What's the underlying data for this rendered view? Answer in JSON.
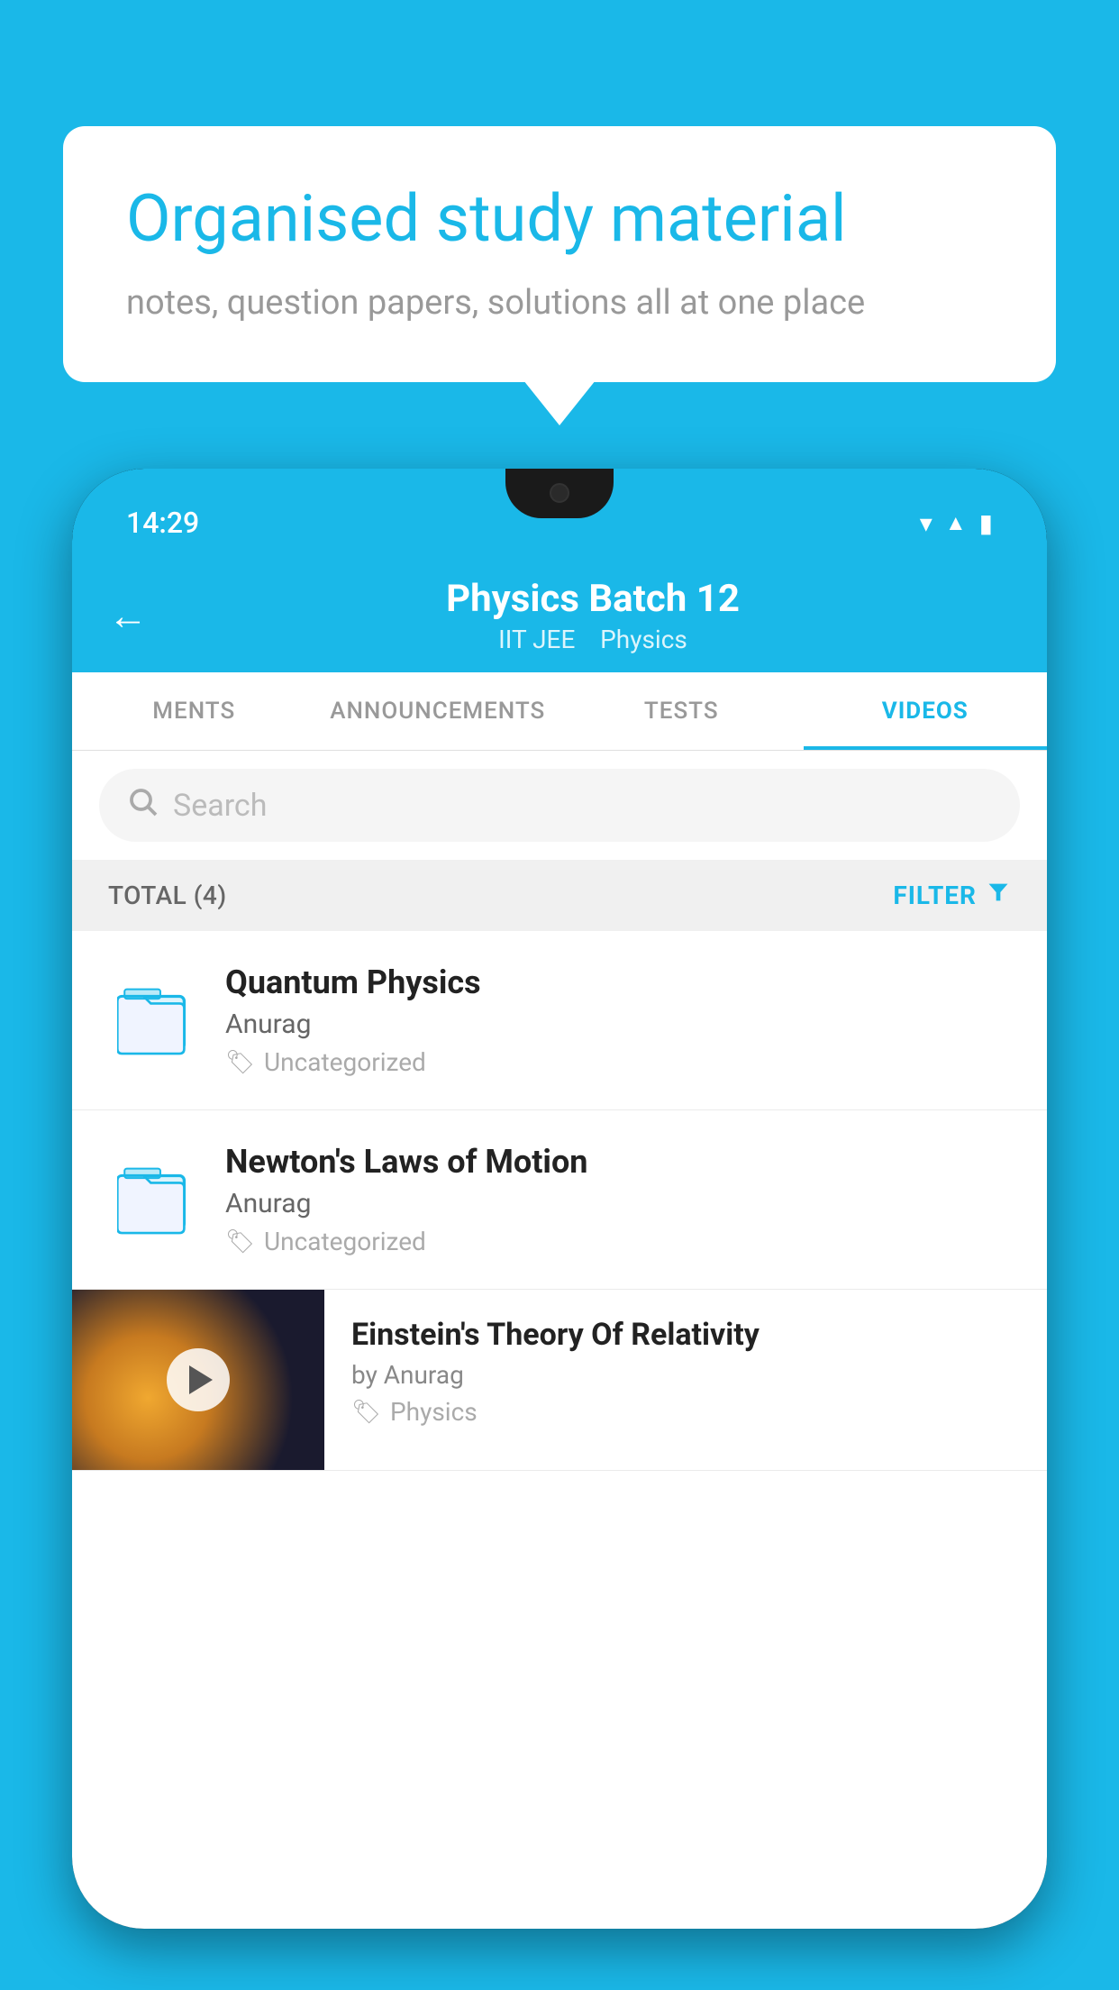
{
  "background_color": "#1ab8e8",
  "speech_bubble": {
    "heading": "Organised study material",
    "subtext": "notes, question papers, solutions all at one place"
  },
  "phone": {
    "status_bar": {
      "time": "14:29"
    },
    "app_header": {
      "back_label": "←",
      "title": "Physics Batch 12",
      "subtitle_tag1": "IIT JEE",
      "subtitle_tag2": "Physics"
    },
    "tabs": [
      {
        "label": "MENTS",
        "active": false
      },
      {
        "label": "ANNOUNCEMENTS",
        "active": false
      },
      {
        "label": "TESTS",
        "active": false
      },
      {
        "label": "VIDEOS",
        "active": true
      }
    ],
    "search": {
      "placeholder": "Search"
    },
    "filter_bar": {
      "total_label": "TOTAL (4)",
      "filter_label": "FILTER"
    },
    "videos": [
      {
        "type": "folder",
        "title": "Quantum Physics",
        "author": "Anurag",
        "tag": "Uncategorized"
      },
      {
        "type": "folder",
        "title": "Newton's Laws of Motion",
        "author": "Anurag",
        "tag": "Uncategorized"
      },
      {
        "type": "thumbnail",
        "title": "Einstein's Theory Of Relativity",
        "by_author": "by Anurag",
        "tag": "Physics"
      }
    ]
  }
}
